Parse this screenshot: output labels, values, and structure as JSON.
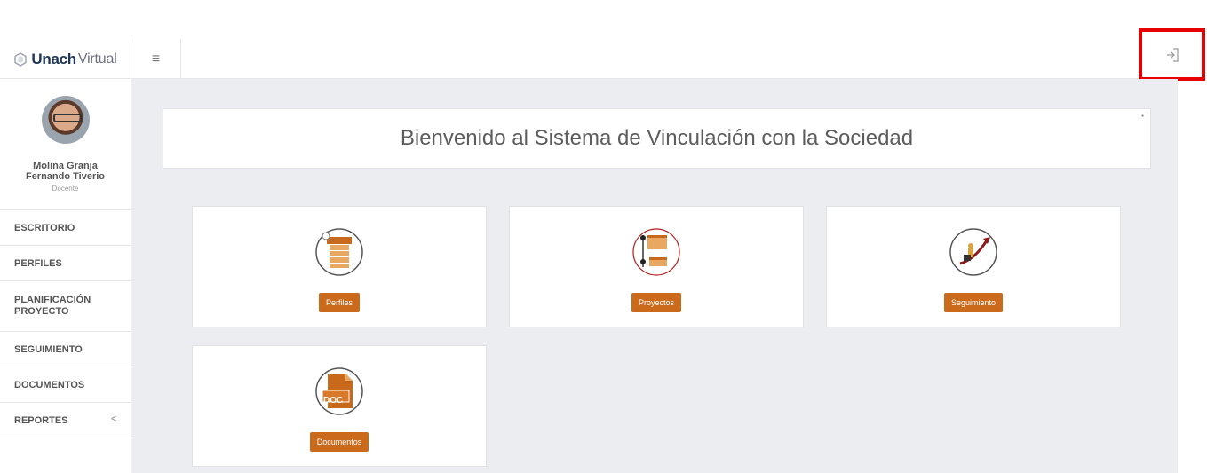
{
  "header": {
    "logo_strong": "Unach",
    "logo_light": "Virtual",
    "menu_icon": "hamburger-icon",
    "logout_icon": "sign-out-icon"
  },
  "sidebar": {
    "user_name": "Molina Granja Fernando Tiverio",
    "user_role": "Docente",
    "items": [
      {
        "label": "ESCRITORIO"
      },
      {
        "label": "PERFILES"
      },
      {
        "label": "PLANIFICACIÓN PROYECTO"
      },
      {
        "label": "SEGUIMIENTO"
      },
      {
        "label": "DOCUMENTOS"
      },
      {
        "label": "REPORTES",
        "chevron": "<"
      }
    ]
  },
  "main": {
    "welcome": "Bienvenido al Sistema de Vinculación con la Sociedad",
    "collapse_icon": "collapse-icon",
    "cards": [
      {
        "label": "Perfiles",
        "icon": "profiles-icon"
      },
      {
        "label": "Proyectos",
        "icon": "projects-icon"
      },
      {
        "label": "Seguimiento",
        "icon": "tracking-icon"
      },
      {
        "label": "Documentos",
        "icon": "doc-icon",
        "icon_text": "DOC"
      }
    ]
  },
  "colors": {
    "accent": "#cc6a1b",
    "highlight_border": "#e60000",
    "content_bg": "#ebedf0",
    "brand_text": "#1d3557"
  }
}
